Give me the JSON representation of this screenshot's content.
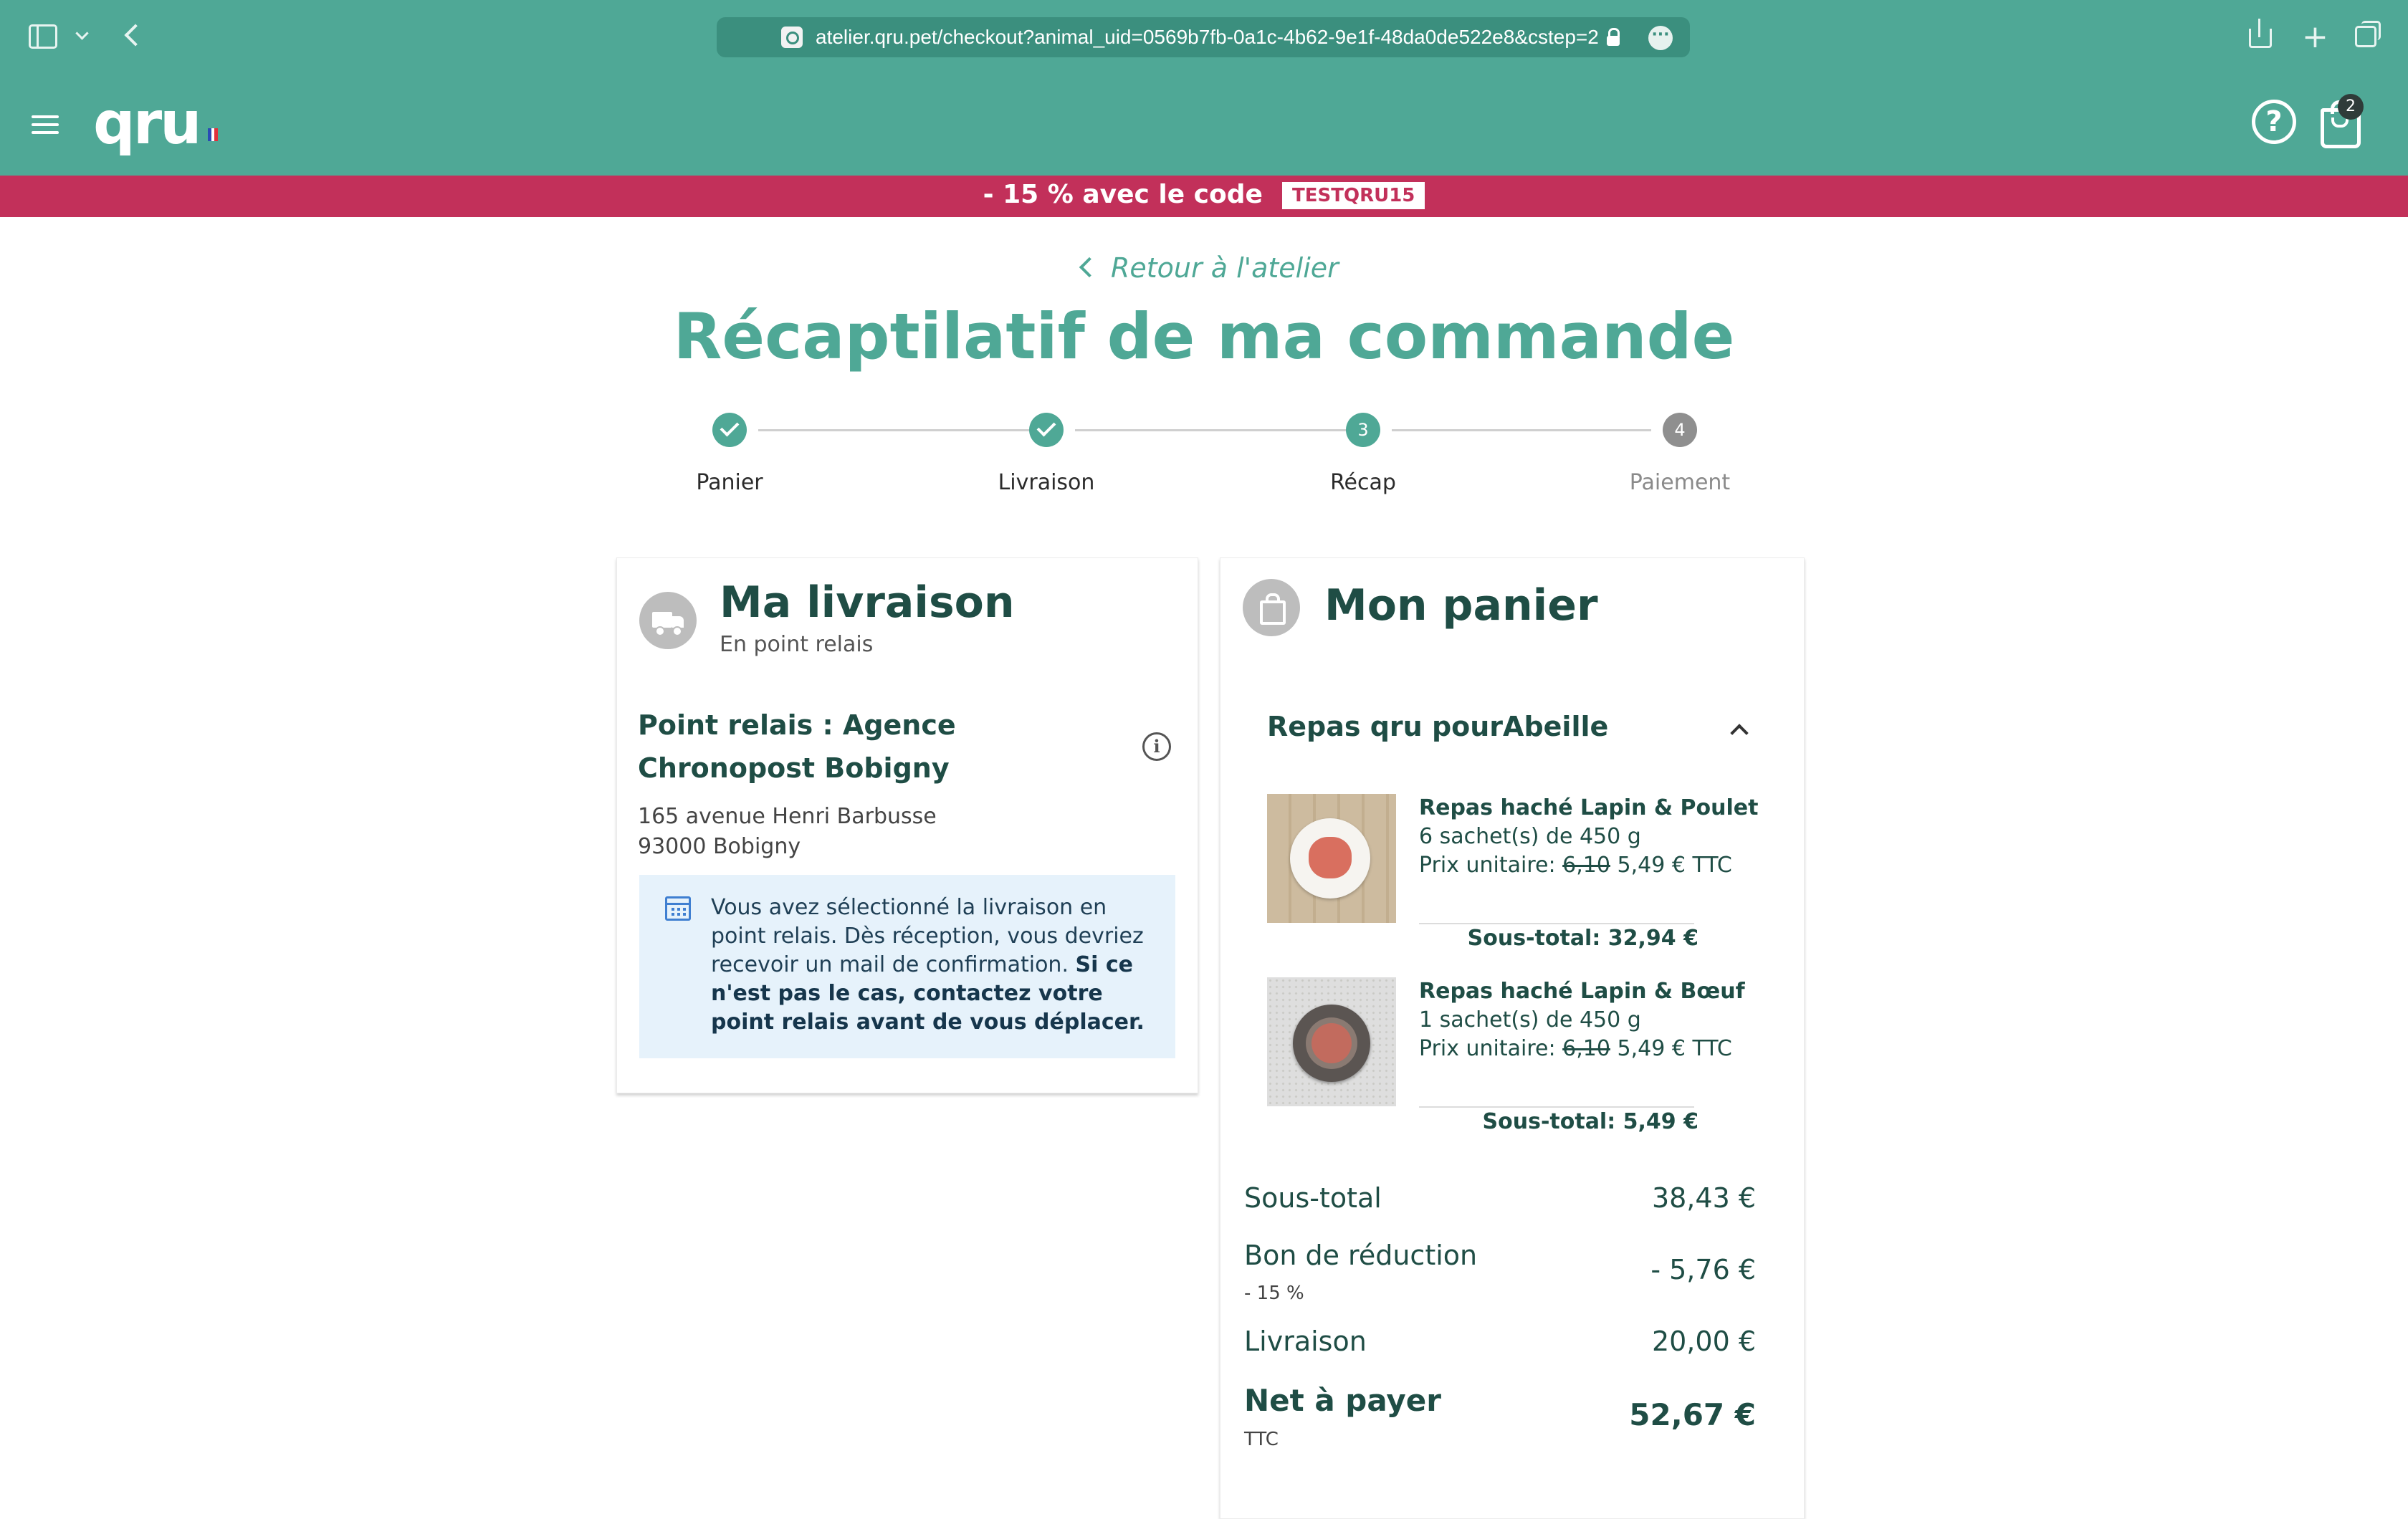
{
  "browser": {
    "url": "atelier.qru.pet/checkout?animal_uid=0569b7fb-0a1c-4b62-9e1f-48da0de522e8&cstep=2"
  },
  "header": {
    "logo_text": "qru",
    "cart_count": "2"
  },
  "promo": {
    "text": "- 15 % avec le code",
    "code": "TESTQRU15"
  },
  "page": {
    "back_link": "Retour à l'atelier",
    "title": "Récaptilatif de ma commande"
  },
  "stepper": {
    "steps": [
      {
        "label": "Panier",
        "number": "1",
        "state": "done"
      },
      {
        "label": "Livraison",
        "number": "2",
        "state": "done"
      },
      {
        "label": "Récap",
        "number": "3",
        "state": "current"
      },
      {
        "label": "Paiement",
        "number": "4",
        "state": "todo"
      }
    ]
  },
  "delivery": {
    "title": "Ma livraison",
    "subtitle": "En point relais",
    "relay_name": "Point relais : Agence Chronopost Bobigny",
    "address_line1": "165 avenue Henri Barbusse",
    "address_line2": "93000 Bobigny",
    "notice_text": "Vous avez sélectionné la livraison en point relais. Dès réception, vous devriez recevoir un mail de confirmation.",
    "notice_bold": "Si ce n'est pas le cas, contactez votre point relais avant de vous déplacer."
  },
  "cart": {
    "title": "Mon panier",
    "group_title": "Repas qru pourAbeille",
    "products": [
      {
        "name": "Repas haché Lapin & Poulet",
        "quantity": "6 sachet(s) de 450 g",
        "price_label": "Prix unitaire:",
        "old_price": "6,10",
        "price": "5,49 € TTC",
        "subtotal": "Sous-total: 32,94 €"
      },
      {
        "name": "Repas haché Lapin & Bœuf",
        "quantity": "1 sachet(s) de 450 g",
        "price_label": "Prix unitaire:",
        "old_price": "6,10",
        "price": "5,49 € TTC",
        "subtotal": "Sous-total: 5,49 €"
      }
    ],
    "totals": {
      "subtotal_label": "Sous-total",
      "subtotal_value": "38,43 €",
      "discount_label": "Bon de réduction",
      "discount_detail": "- 15 %",
      "discount_value": "- 5,76 €",
      "shipping_label": "Livraison",
      "shipping_value": "20,00 €",
      "net_label": "Net à payer",
      "net_detail": "TTC",
      "net_value": "52,67 €"
    }
  },
  "colors": {
    "brand_green": "#4fa896",
    "promo_pink": "#c2305a",
    "dark_text": "#1f4d45"
  }
}
